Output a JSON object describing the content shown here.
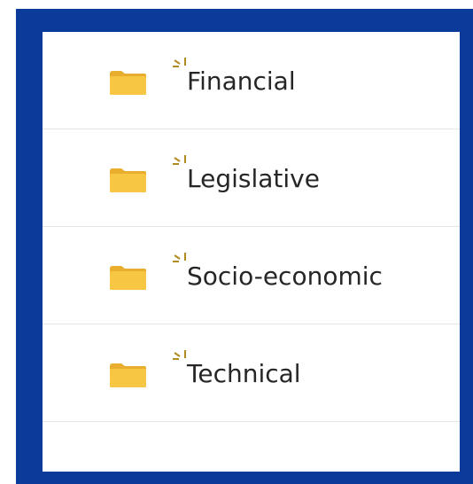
{
  "folders": [
    {
      "label": "Financial",
      "icon": "folder-icon",
      "new_indicator": "new-sparkle-icon"
    },
    {
      "label": "Legislative",
      "icon": "folder-icon",
      "new_indicator": "new-sparkle-icon"
    },
    {
      "label": "Socio-economic",
      "icon": "folder-icon",
      "new_indicator": "new-sparkle-icon"
    },
    {
      "label": "Technical",
      "icon": "folder-icon",
      "new_indicator": "new-sparkle-icon"
    }
  ],
  "colors": {
    "frame": "#0a3a9a",
    "folder": "#f5c242",
    "sparkle": "#b08a1e",
    "text": "#262626"
  }
}
